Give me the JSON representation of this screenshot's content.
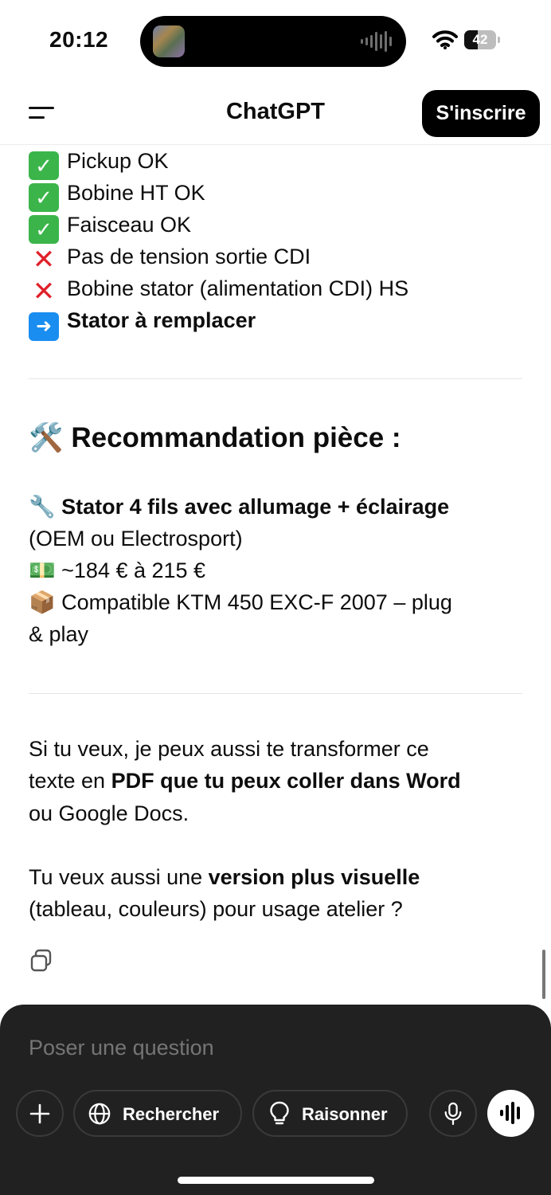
{
  "status_bar": {
    "time": "20:12",
    "battery_level": "42",
    "battery_fraction": 0.42
  },
  "header": {
    "title": "ChatGPT",
    "signup_label": "S'inscrire"
  },
  "message": {
    "checklist": [
      {
        "icon": "check-mark-icon",
        "text": "Pickup OK"
      },
      {
        "icon": "check-mark-icon",
        "text": "Bobine HT OK"
      },
      {
        "icon": "check-mark-icon",
        "text": "Faisceau OK"
      },
      {
        "icon": "cross-mark-icon",
        "text": "Pas de tension sortie CDI"
      },
      {
        "icon": "cross-mark-icon",
        "text": "Bobine stator (alimentation CDI) HS"
      },
      {
        "icon": "right-arrow-icon",
        "text": "Stator à remplacer"
      }
    ],
    "section_emoji": "🛠️",
    "section_title": "Recommandation pièce :",
    "part": {
      "wrench_emoji": "🔧",
      "name": "Stator 4 fils avec allumage + éclairage",
      "brand": "(OEM ou Electrosport)",
      "money_emoji": "💵",
      "price": "~184 € à 215 €",
      "package_emoji": "📦",
      "compat_line1": "Compatible KTM 450 EXC-F 2007 – plug",
      "compat_line2": "& play"
    },
    "offer": {
      "line1": "Si tu veux, je peux aussi te transformer ce",
      "line2_prefix": "texte en ",
      "line2_bold": "PDF que tu peux coller dans Word",
      "line3": "ou Google Docs."
    },
    "question": {
      "prefix": "Tu veux aussi une ",
      "bold": "version plus visuelle",
      "line2": "(tableau, couleurs) pour usage atelier ?"
    }
  },
  "composer": {
    "placeholder": "Poser une question",
    "search_label": "Rechercher",
    "reason_label": "Raisonner"
  }
}
